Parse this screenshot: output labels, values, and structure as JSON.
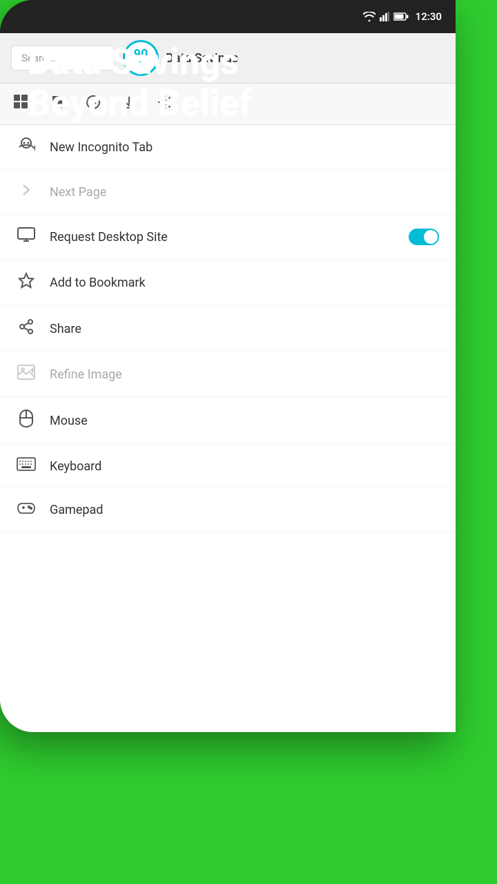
{
  "hero": {
    "line1": "Data Savings",
    "line2": "Beyond Belief"
  },
  "status_bar": {
    "time": "12:30"
  },
  "browser": {
    "search_placeholder": "Searc...",
    "data_savings_number": "90",
    "data_savings_percent": "%",
    "data_savings_label": "Data Savings"
  },
  "toolbar": {
    "icons": [
      "grid-icon",
      "bookmarks-icon",
      "history-icon",
      "download-icon",
      "settings-icon"
    ]
  },
  "menu": {
    "items": [
      {
        "id": "new-incognito",
        "label": "New Incognito Tab",
        "icon": "incognito-icon",
        "disabled": false,
        "has_toggle": false
      },
      {
        "id": "next-page",
        "label": "Next Page",
        "icon": "chevron-right-icon",
        "disabled": true,
        "has_toggle": false
      },
      {
        "id": "request-desktop",
        "label": "Request Desktop Site",
        "icon": "desktop-icon",
        "disabled": false,
        "has_toggle": true
      },
      {
        "id": "add-bookmark",
        "label": "Add to Bookmark",
        "icon": "star-outline-icon",
        "disabled": false,
        "has_toggle": false
      },
      {
        "id": "share",
        "label": "Share",
        "icon": "share-icon",
        "disabled": false,
        "has_toggle": false
      },
      {
        "id": "refine-image",
        "label": "Refine Image",
        "icon": "image-icon",
        "disabled": true,
        "has_toggle": false
      },
      {
        "id": "mouse",
        "label": "Mouse",
        "icon": "mouse-icon",
        "disabled": false,
        "has_toggle": false
      },
      {
        "id": "keyboard",
        "label": "Keyboard",
        "icon": "keyboard-icon",
        "disabled": false,
        "has_toggle": false
      },
      {
        "id": "gamepad",
        "label": "Gamepad",
        "icon": "gamepad-icon",
        "disabled": false,
        "has_toggle": false
      }
    ]
  }
}
